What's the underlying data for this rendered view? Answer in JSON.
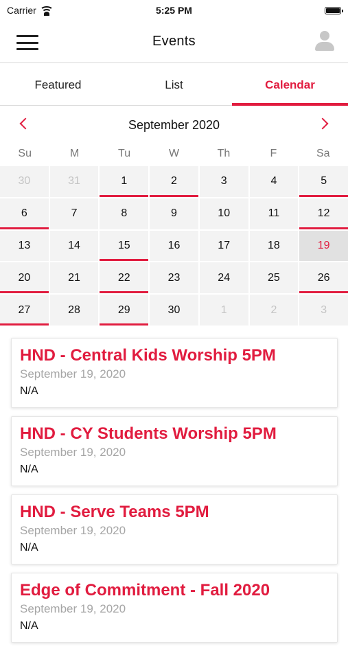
{
  "status_bar": {
    "carrier": "Carrier",
    "time": "5:25 PM"
  },
  "header": {
    "title": "Events"
  },
  "tabs": [
    {
      "label": "Featured",
      "active": false
    },
    {
      "label": "List",
      "active": false
    },
    {
      "label": "Calendar",
      "active": true
    }
  ],
  "calendar": {
    "month_label": "September 2020",
    "weekdays": [
      "Su",
      "M",
      "Tu",
      "W",
      "Th",
      "F",
      "Sa"
    ],
    "days": [
      {
        "label": "30",
        "muted": true,
        "event": false,
        "selected": false
      },
      {
        "label": "31",
        "muted": true,
        "event": false,
        "selected": false
      },
      {
        "label": "1",
        "muted": false,
        "event": true,
        "selected": false
      },
      {
        "label": "2",
        "muted": false,
        "event": true,
        "selected": false
      },
      {
        "label": "3",
        "muted": false,
        "event": false,
        "selected": false
      },
      {
        "label": "4",
        "muted": false,
        "event": false,
        "selected": false
      },
      {
        "label": "5",
        "muted": false,
        "event": true,
        "selected": false
      },
      {
        "label": "6",
        "muted": false,
        "event": true,
        "selected": false
      },
      {
        "label": "7",
        "muted": false,
        "event": false,
        "selected": false
      },
      {
        "label": "8",
        "muted": false,
        "event": false,
        "selected": false
      },
      {
        "label": "9",
        "muted": false,
        "event": false,
        "selected": false
      },
      {
        "label": "10",
        "muted": false,
        "event": false,
        "selected": false
      },
      {
        "label": "11",
        "muted": false,
        "event": false,
        "selected": false
      },
      {
        "label": "12",
        "muted": false,
        "event": true,
        "selected": false
      },
      {
        "label": "13",
        "muted": false,
        "event": false,
        "selected": false
      },
      {
        "label": "14",
        "muted": false,
        "event": false,
        "selected": false
      },
      {
        "label": "15",
        "muted": false,
        "event": true,
        "selected": false
      },
      {
        "label": "16",
        "muted": false,
        "event": false,
        "selected": false
      },
      {
        "label": "17",
        "muted": false,
        "event": false,
        "selected": false
      },
      {
        "label": "18",
        "muted": false,
        "event": false,
        "selected": false
      },
      {
        "label": "19",
        "muted": false,
        "event": false,
        "selected": true
      },
      {
        "label": "20",
        "muted": false,
        "event": true,
        "selected": false
      },
      {
        "label": "21",
        "muted": false,
        "event": false,
        "selected": false
      },
      {
        "label": "22",
        "muted": false,
        "event": true,
        "selected": false
      },
      {
        "label": "23",
        "muted": false,
        "event": false,
        "selected": false
      },
      {
        "label": "24",
        "muted": false,
        "event": false,
        "selected": false
      },
      {
        "label": "25",
        "muted": false,
        "event": false,
        "selected": false
      },
      {
        "label": "26",
        "muted": false,
        "event": true,
        "selected": false
      },
      {
        "label": "27",
        "muted": false,
        "event": true,
        "selected": false
      },
      {
        "label": "28",
        "muted": false,
        "event": false,
        "selected": false
      },
      {
        "label": "29",
        "muted": false,
        "event": true,
        "selected": false
      },
      {
        "label": "30",
        "muted": false,
        "event": false,
        "selected": false
      },
      {
        "label": "1",
        "muted": true,
        "event": false,
        "selected": false
      },
      {
        "label": "2",
        "muted": true,
        "event": false,
        "selected": false
      },
      {
        "label": "3",
        "muted": true,
        "event": false,
        "selected": false
      }
    ]
  },
  "events": [
    {
      "title": "HND - Central Kids Worship 5PM",
      "date": "September 19, 2020",
      "location": "N/A"
    },
    {
      "title": "HND - CY Students Worship 5PM",
      "date": "September 19, 2020",
      "location": "N/A"
    },
    {
      "title": "HND - Serve Teams 5PM",
      "date": "September 19, 2020",
      "location": "N/A"
    },
    {
      "title": "Edge of Commitment - Fall 2020",
      "date": "September 19, 2020",
      "location": "N/A"
    }
  ],
  "colors": {
    "accent": "#e11c3f",
    "cell_bg": "#f3f3f3",
    "selected_bg": "#e1e1e1"
  },
  "icons": [
    "menu-icon",
    "wifi-icon",
    "battery-icon",
    "user-avatar-icon",
    "chevron-left-icon",
    "chevron-right-icon"
  ]
}
